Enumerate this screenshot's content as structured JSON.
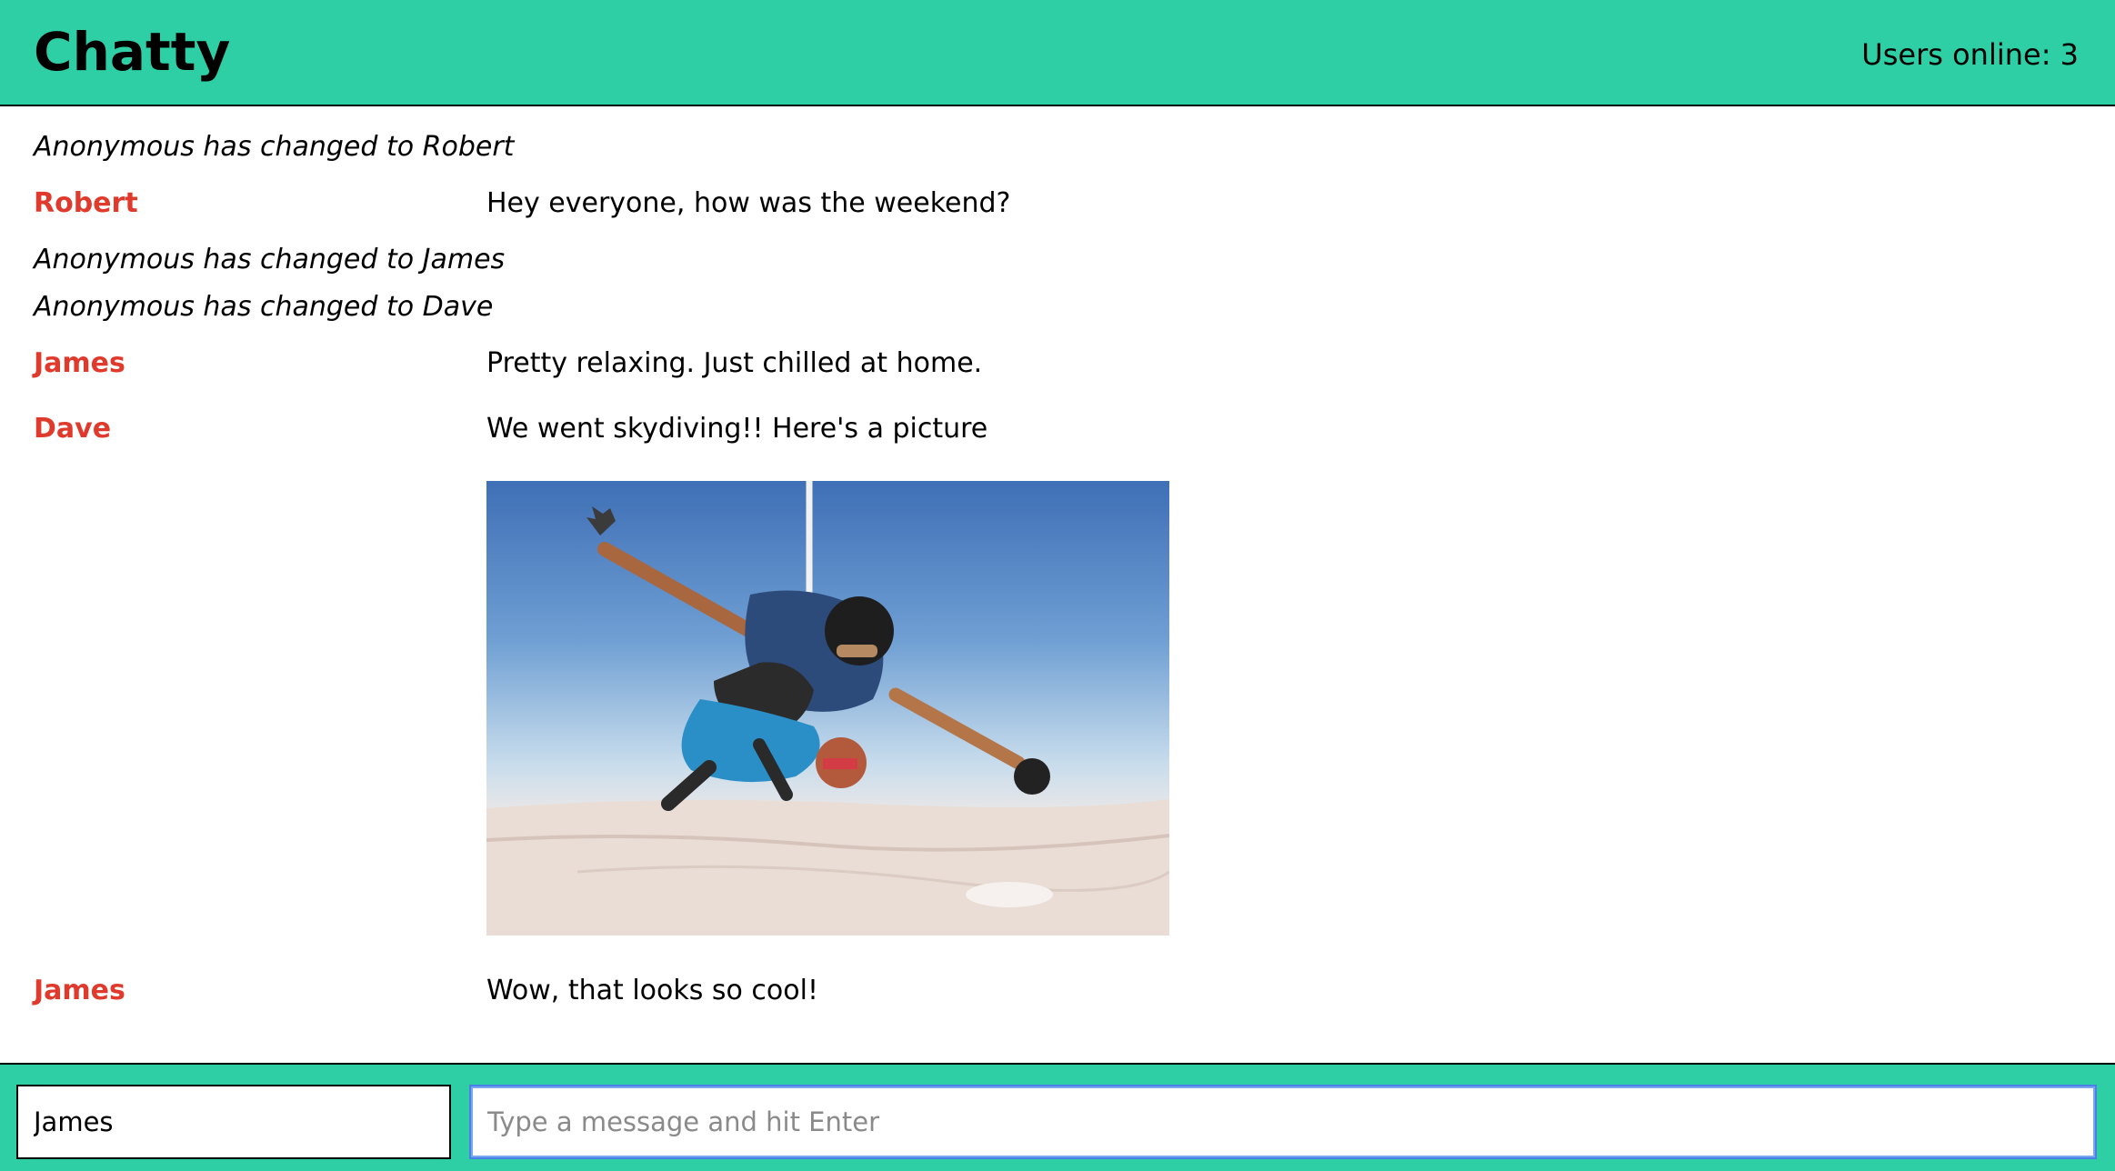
{
  "navbar": {
    "title": "Chatty",
    "users_online": "Users online: 3"
  },
  "messages": [
    {
      "type": "system",
      "text": "Anonymous has changed to Robert"
    },
    {
      "type": "message",
      "user": "Robert",
      "text": "Hey everyone, how was the weekend?"
    },
    {
      "type": "system",
      "text": "Anonymous has changed to James"
    },
    {
      "type": "system",
      "text": "Anonymous has changed to Dave"
    },
    {
      "type": "message",
      "user": "James",
      "text": "Pretty relaxing. Just chilled at home."
    },
    {
      "type": "message",
      "user": "Dave",
      "text": "We went skydiving!! Here's a picture",
      "image": "tandem-skydiving-photo"
    },
    {
      "type": "message",
      "user": "James",
      "text": "Wow, that looks so cool!"
    }
  ],
  "chatbar": {
    "username_value": "James",
    "message_placeholder": "Type a message and hit Enter"
  },
  "colors": {
    "accent": "#2ecfa5",
    "username": "#e03a2d",
    "focus_border": "#4b80e6"
  }
}
